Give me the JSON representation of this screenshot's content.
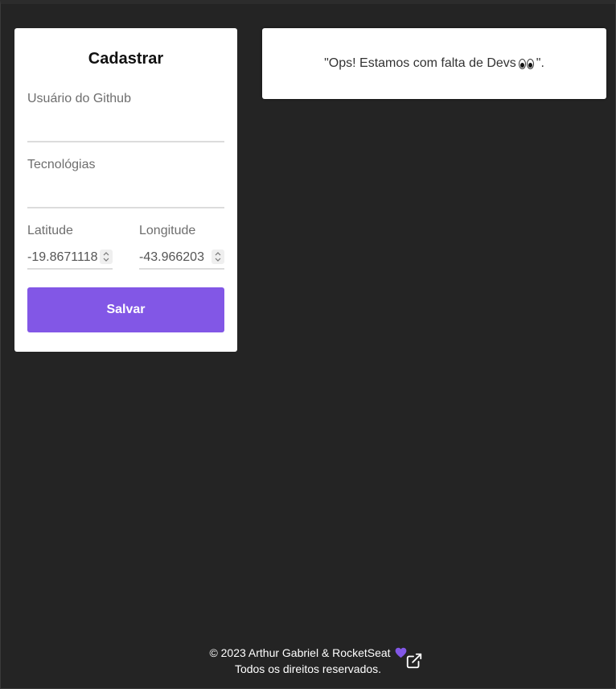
{
  "form": {
    "title": "Cadastrar",
    "github_label": "Usuário do Github",
    "github_value": "",
    "techs_label": "Tecnológias",
    "techs_value": "",
    "latitude_label": "Latitude",
    "latitude_value": "-19.8671118",
    "longitude_label": "Longitude",
    "longitude_value": "-43.966203",
    "save_label": "Salvar"
  },
  "dev_list": {
    "empty_prefix": "\"Ops! Estamos com falta de Devs",
    "empty_suffix": "\".",
    "emoji_icon": "eyes-icon"
  },
  "footer": {
    "copyright": "© 2023 Arthur Gabriel & RocketSeat",
    "rights": "Todos os direitos reservados.",
    "heart_icon": "heart-icon",
    "link_icon": "external-link-icon"
  },
  "colors": {
    "background": "#242424",
    "accent": "#8257e6",
    "card": "#ffffff"
  }
}
